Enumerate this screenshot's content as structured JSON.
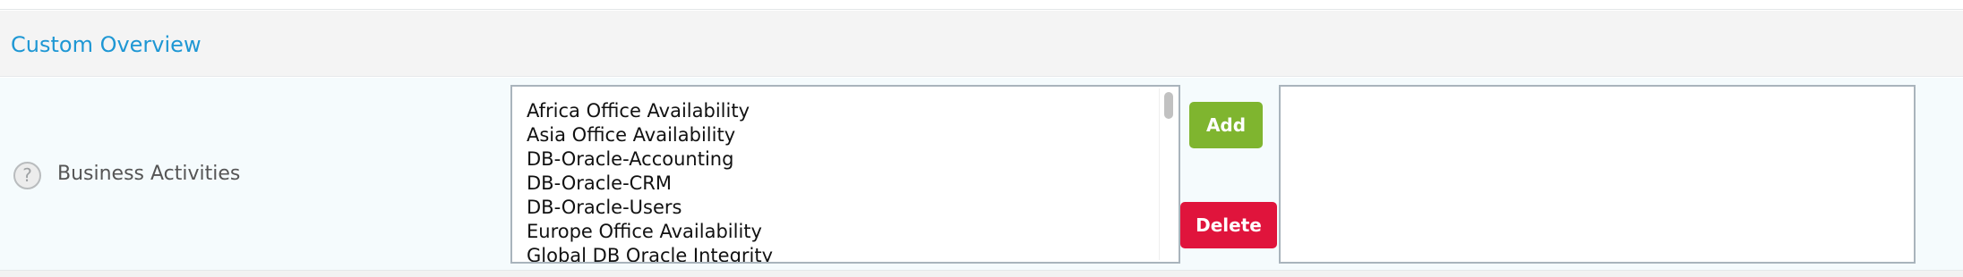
{
  "section": {
    "title": "Custom Overview"
  },
  "field": {
    "label": "Business Activities",
    "help_icon_glyph": "?",
    "available_options": [
      "Africa Office Availability",
      "Asia Office Availability",
      "DB-Oracle-Accounting",
      "DB-Oracle-CRM",
      "DB-Oracle-Users",
      "Europe Office Availability",
      "Global DB Oracle Integrity"
    ],
    "selected_options": []
  },
  "buttons": {
    "add_label": "Add",
    "delete_label": "Delete"
  },
  "colors": {
    "title": "#1e97d4",
    "add_button": "#7fb52f",
    "delete_button": "#e0143c"
  }
}
